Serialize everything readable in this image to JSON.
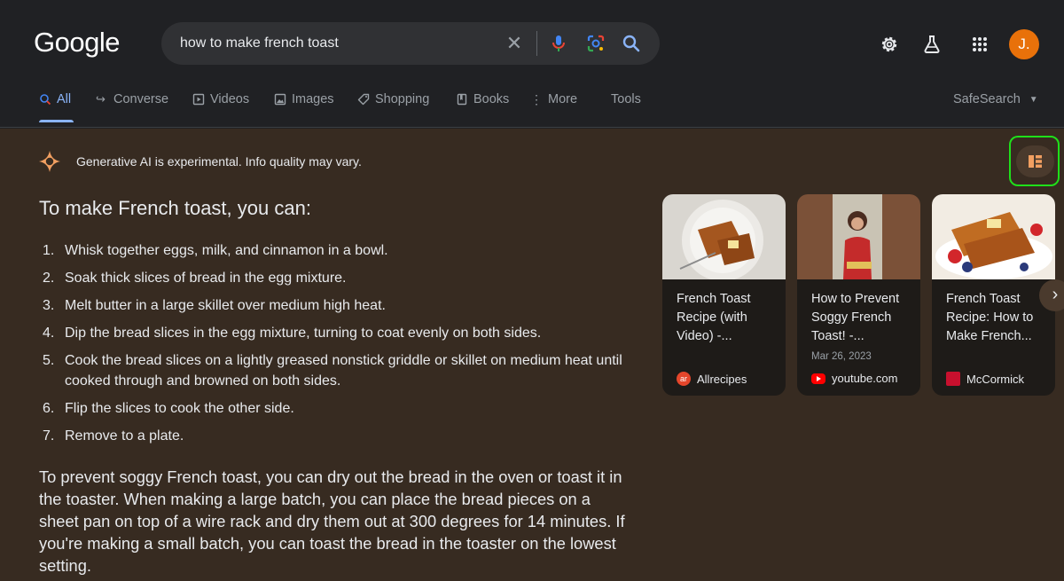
{
  "header": {
    "logo": "Google",
    "search": {
      "query": "how to make french toast"
    },
    "icons": [
      "settings-gear-icon",
      "labs-flask-icon",
      "apps-grid-icon"
    ],
    "avatar_initial": "J."
  },
  "tabs": [
    {
      "label": "All",
      "icon": "search-icon",
      "active": true
    },
    {
      "label": "Converse",
      "icon": "converse-arrow-icon"
    },
    {
      "label": "Videos",
      "icon": "video-icon"
    },
    {
      "label": "Images",
      "icon": "image-icon"
    },
    {
      "label": "Shopping",
      "icon": "tag-icon"
    },
    {
      "label": "Books",
      "icon": "book-icon"
    },
    {
      "label": "More",
      "icon": "more-vert-icon"
    },
    {
      "label": "Tools"
    }
  ],
  "safesearch_label": "SafeSearch",
  "ai": {
    "notice": "Generative AI is experimental. Info quality may vary.",
    "heading": "To make French toast, you can:",
    "steps": [
      "Whisk together eggs, milk, and cinnamon in a bowl.",
      "Soak thick slices of bread in the egg mixture.",
      "Melt butter in a large skillet over medium high heat.",
      "Dip the bread slices in the egg mixture, turning to coat evenly on both sides.",
      "Cook the bread slices on a lightly greased nonstick griddle or skillet on medium heat until cooked through and browned on both sides.",
      "Flip the slices to cook the other side.",
      "Remove to a plate."
    ],
    "paragraph": "To prevent soggy French toast, you can dry out the bread in the oven or toast it in the toaster. When making a large batch, you can place the bread pieces on a sheet pan on top of a wire rack and dry them out at 300 degrees for 14 minutes. If you're making a small batch, you can toast the bread in the toaster on the lowest setting."
  },
  "cards": [
    {
      "title": "French Toast Recipe (with Video) -...",
      "date": "",
      "source": "Allrecipes"
    },
    {
      "title": "How to Prevent Soggy French Toast! -...",
      "date": "Mar 26, 2023",
      "source": "youtube.com"
    },
    {
      "title": "French Toast Recipe: How to Make French...",
      "date": "",
      "source": "McCormick"
    }
  ],
  "colors": {
    "background": "#202124",
    "ai_panel": "#372b21",
    "accent": "#8ab4f8",
    "highlight_border": "#1fe01a",
    "avatar": "#e8710a"
  }
}
